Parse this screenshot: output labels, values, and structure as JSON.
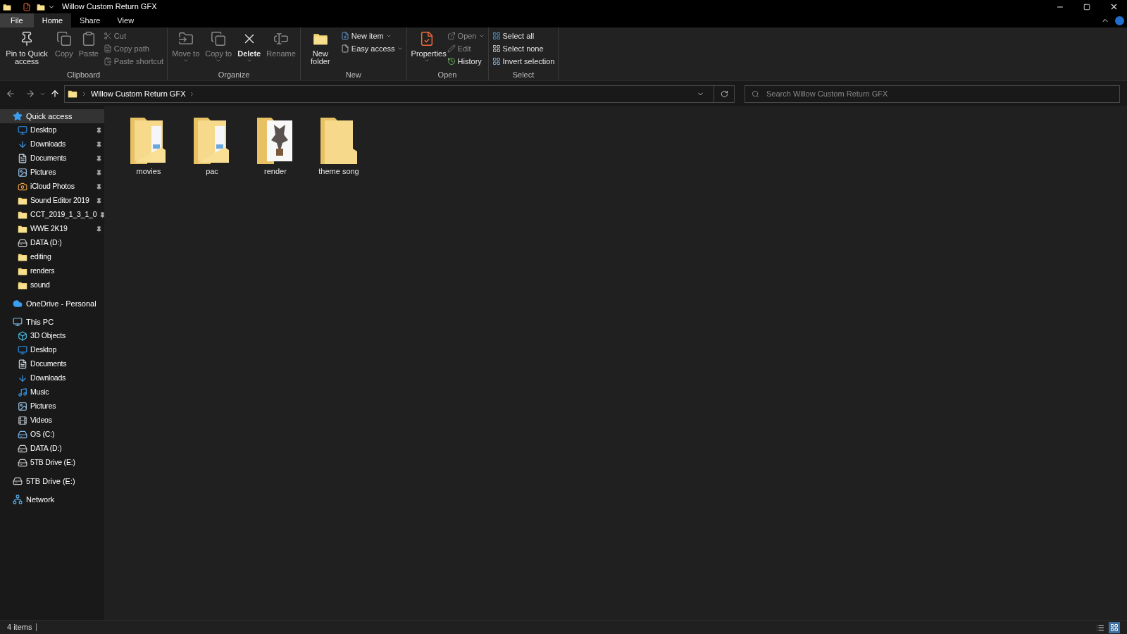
{
  "window": {
    "title": "Willow Custom Return GFX"
  },
  "tabs": [
    {
      "label": "File",
      "kind": "file",
      "selected": false
    },
    {
      "label": "Home",
      "kind": "tab",
      "selected": true
    },
    {
      "label": "Share",
      "kind": "tab",
      "selected": false
    },
    {
      "label": "View",
      "kind": "tab",
      "selected": false
    }
  ],
  "ribbon": [
    {
      "label": "Clipboard",
      "columns": [
        {
          "kind": "large",
          "label": "Pin to Quick access",
          "disabled": false,
          "dropdown": false
        },
        {
          "kind": "large",
          "label": "Copy",
          "disabled": true,
          "dropdown": false
        },
        {
          "kind": "large",
          "label": "Paste",
          "disabled": true,
          "dropdown": false
        },
        {
          "kind": "stack",
          "items": [
            {
              "label": "Cut",
              "disabled": true,
              "dropdown": false
            },
            {
              "label": "Copy path",
              "disabled": true,
              "dropdown": false
            },
            {
              "label": "Paste shortcut",
              "disabled": true,
              "dropdown": false
            }
          ]
        }
      ]
    },
    {
      "label": "Organize",
      "columns": [
        {
          "kind": "large",
          "label": "Move to",
          "disabled": true,
          "dropdown": true
        },
        {
          "kind": "large",
          "label": "Copy to",
          "disabled": true,
          "dropdown": true
        },
        {
          "kind": "large",
          "label": "Delete",
          "disabled": false,
          "dropdown": true
        },
        {
          "kind": "large",
          "label": "Rename",
          "disabled": true,
          "dropdown": false
        }
      ]
    },
    {
      "label": "New",
      "columns": [
        {
          "kind": "large",
          "label": "New folder",
          "disabled": false,
          "dropdown": false
        },
        {
          "kind": "stack",
          "items": [
            {
              "label": "New item",
              "disabled": false,
              "dropdown": true
            },
            {
              "label": "Easy access",
              "disabled": false,
              "dropdown": true
            }
          ]
        }
      ]
    },
    {
      "label": "Open",
      "columns": [
        {
          "kind": "large",
          "label": "Properties",
          "disabled": false,
          "dropdown": true
        },
        {
          "kind": "stack",
          "items": [
            {
              "label": "Open",
              "disabled": true,
              "dropdown": true
            },
            {
              "label": "Edit",
              "disabled": true,
              "dropdown": false
            },
            {
              "label": "History",
              "disabled": false,
              "dropdown": false
            }
          ]
        }
      ]
    },
    {
      "label": "Select",
      "columns": [
        {
          "kind": "stack",
          "items": [
            {
              "label": "Select all",
              "disabled": false,
              "dropdown": false
            },
            {
              "label": "Select none",
              "disabled": false,
              "dropdown": false
            },
            {
              "label": "Invert selection",
              "disabled": false,
              "dropdown": false
            }
          ]
        }
      ]
    }
  ],
  "address": {
    "path": [
      "Willow Custom Return GFX"
    ],
    "search_placeholder": "Search Willow Custom Return GFX"
  },
  "sidebar": [
    {
      "label": "Quick access",
      "selected": true,
      "children": [
        {
          "label": "Desktop",
          "pinned": true,
          "selected": false
        },
        {
          "label": "Downloads",
          "pinned": true,
          "selected": false
        },
        {
          "label": "Documents",
          "pinned": true,
          "selected": false
        },
        {
          "label": "Pictures",
          "pinned": true,
          "selected": false
        },
        {
          "label": "iCloud Photos",
          "pinned": true,
          "selected": false
        },
        {
          "label": "Sound Editor 2019",
          "pinned": true,
          "selected": false
        },
        {
          "label": "CCT_2019_1_3_1_0",
          "pinned": true,
          "selected": false
        },
        {
          "label": "WWE 2K19",
          "pinned": true,
          "selected": false
        },
        {
          "label": "DATA (D:)",
          "pinned": false,
          "selected": false
        },
        {
          "label": "editing",
          "pinned": false,
          "selected": false
        },
        {
          "label": "renders",
          "pinned": false,
          "selected": false
        },
        {
          "label": "sound",
          "pinned": false,
          "selected": false
        }
      ]
    },
    {
      "label": "OneDrive - Personal",
      "selected": false
    },
    {
      "label": "This PC",
      "selected": false,
      "children": [
        {
          "label": "3D Objects",
          "selected": false
        },
        {
          "label": "Desktop",
          "selected": false
        },
        {
          "label": "Documents",
          "selected": false
        },
        {
          "label": "Downloads",
          "selected": false
        },
        {
          "label": "Music",
          "selected": false
        },
        {
          "label": "Pictures",
          "selected": false
        },
        {
          "label": "Videos",
          "selected": false
        },
        {
          "label": "OS (C:)",
          "selected": false
        },
        {
          "label": "DATA (D:)",
          "selected": false
        },
        {
          "label": "5TB Drive (E:)",
          "selected": false
        }
      ]
    },
    {
      "label": "5TB Drive (E:)",
      "selected": false
    },
    {
      "label": "Network",
      "selected": false
    }
  ],
  "folders": [
    {
      "name": "movies",
      "selected": false
    },
    {
      "name": "pac",
      "selected": false
    },
    {
      "name": "render",
      "selected": false
    },
    {
      "name": "theme song",
      "selected": false
    }
  ],
  "status_bar": {
    "count": "4 items",
    "views": [
      {
        "kind": "details",
        "selected": false
      },
      {
        "kind": "large",
        "selected": true
      }
    ]
  }
}
